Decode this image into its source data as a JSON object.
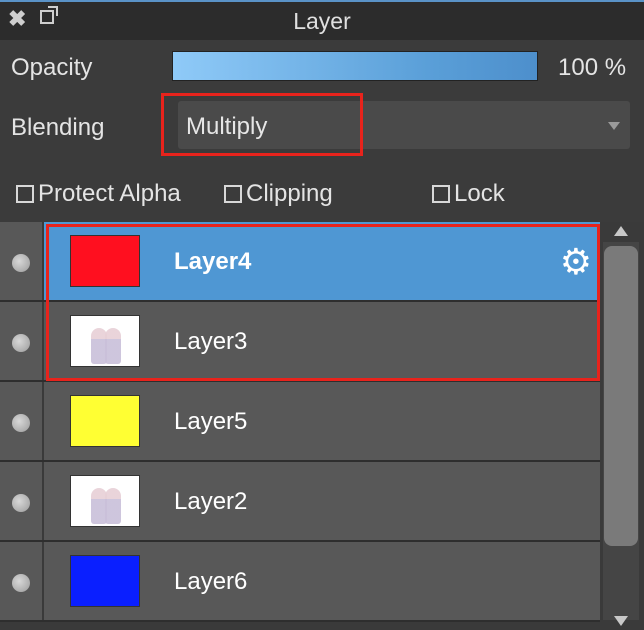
{
  "panel": {
    "title": "Layer"
  },
  "opacity": {
    "label": "Opacity",
    "value_text": "100 %",
    "level": 1.0
  },
  "blending": {
    "label": "Blending",
    "selected": "Multiply"
  },
  "options": {
    "protect_alpha": "Protect Alpha",
    "clipping": "Clipping",
    "lock": "Lock"
  },
  "layers": [
    {
      "name": "Layer4",
      "thumb": "red",
      "color": "#ff0f1f",
      "selected": true
    },
    {
      "name": "Layer3",
      "thumb": "image",
      "selected": false
    },
    {
      "name": "Layer5",
      "thumb": "yellow",
      "color": "#ffff33",
      "selected": false
    },
    {
      "name": "Layer2",
      "thumb": "image",
      "selected": false
    },
    {
      "name": "Layer6",
      "thumb": "blue",
      "color": "#0a1fff",
      "selected": false
    }
  ],
  "icons": {
    "close": "close-icon",
    "popout": "popout-icon",
    "gear": "gear-icon",
    "visibility": "visibility-dot-icon"
  },
  "colors": {
    "selection": "#4f97d3",
    "highlight": "#e8231c"
  }
}
